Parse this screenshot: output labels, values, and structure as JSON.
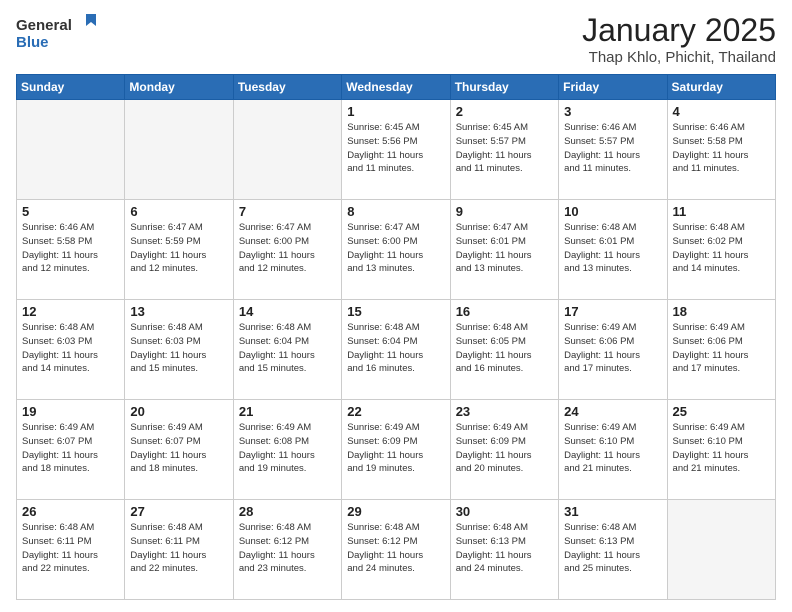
{
  "logo": {
    "line1": "General",
    "line2": "Blue"
  },
  "header": {
    "month": "January 2025",
    "location": "Thap Khlo, Phichit, Thailand"
  },
  "weekdays": [
    "Sunday",
    "Monday",
    "Tuesday",
    "Wednesday",
    "Thursday",
    "Friday",
    "Saturday"
  ],
  "weeks": [
    [
      {
        "day": "",
        "info": ""
      },
      {
        "day": "",
        "info": ""
      },
      {
        "day": "",
        "info": ""
      },
      {
        "day": "1",
        "info": "Sunrise: 6:45 AM\nSunset: 5:56 PM\nDaylight: 11 hours\nand 11 minutes."
      },
      {
        "day": "2",
        "info": "Sunrise: 6:45 AM\nSunset: 5:57 PM\nDaylight: 11 hours\nand 11 minutes."
      },
      {
        "day": "3",
        "info": "Sunrise: 6:46 AM\nSunset: 5:57 PM\nDaylight: 11 hours\nand 11 minutes."
      },
      {
        "day": "4",
        "info": "Sunrise: 6:46 AM\nSunset: 5:58 PM\nDaylight: 11 hours\nand 11 minutes."
      }
    ],
    [
      {
        "day": "5",
        "info": "Sunrise: 6:46 AM\nSunset: 5:58 PM\nDaylight: 11 hours\nand 12 minutes."
      },
      {
        "day": "6",
        "info": "Sunrise: 6:47 AM\nSunset: 5:59 PM\nDaylight: 11 hours\nand 12 minutes."
      },
      {
        "day": "7",
        "info": "Sunrise: 6:47 AM\nSunset: 6:00 PM\nDaylight: 11 hours\nand 12 minutes."
      },
      {
        "day": "8",
        "info": "Sunrise: 6:47 AM\nSunset: 6:00 PM\nDaylight: 11 hours\nand 13 minutes."
      },
      {
        "day": "9",
        "info": "Sunrise: 6:47 AM\nSunset: 6:01 PM\nDaylight: 11 hours\nand 13 minutes."
      },
      {
        "day": "10",
        "info": "Sunrise: 6:48 AM\nSunset: 6:01 PM\nDaylight: 11 hours\nand 13 minutes."
      },
      {
        "day": "11",
        "info": "Sunrise: 6:48 AM\nSunset: 6:02 PM\nDaylight: 11 hours\nand 14 minutes."
      }
    ],
    [
      {
        "day": "12",
        "info": "Sunrise: 6:48 AM\nSunset: 6:03 PM\nDaylight: 11 hours\nand 14 minutes."
      },
      {
        "day": "13",
        "info": "Sunrise: 6:48 AM\nSunset: 6:03 PM\nDaylight: 11 hours\nand 15 minutes."
      },
      {
        "day": "14",
        "info": "Sunrise: 6:48 AM\nSunset: 6:04 PM\nDaylight: 11 hours\nand 15 minutes."
      },
      {
        "day": "15",
        "info": "Sunrise: 6:48 AM\nSunset: 6:04 PM\nDaylight: 11 hours\nand 16 minutes."
      },
      {
        "day": "16",
        "info": "Sunrise: 6:48 AM\nSunset: 6:05 PM\nDaylight: 11 hours\nand 16 minutes."
      },
      {
        "day": "17",
        "info": "Sunrise: 6:49 AM\nSunset: 6:06 PM\nDaylight: 11 hours\nand 17 minutes."
      },
      {
        "day": "18",
        "info": "Sunrise: 6:49 AM\nSunset: 6:06 PM\nDaylight: 11 hours\nand 17 minutes."
      }
    ],
    [
      {
        "day": "19",
        "info": "Sunrise: 6:49 AM\nSunset: 6:07 PM\nDaylight: 11 hours\nand 18 minutes."
      },
      {
        "day": "20",
        "info": "Sunrise: 6:49 AM\nSunset: 6:07 PM\nDaylight: 11 hours\nand 18 minutes."
      },
      {
        "day": "21",
        "info": "Sunrise: 6:49 AM\nSunset: 6:08 PM\nDaylight: 11 hours\nand 19 minutes."
      },
      {
        "day": "22",
        "info": "Sunrise: 6:49 AM\nSunset: 6:09 PM\nDaylight: 11 hours\nand 19 minutes."
      },
      {
        "day": "23",
        "info": "Sunrise: 6:49 AM\nSunset: 6:09 PM\nDaylight: 11 hours\nand 20 minutes."
      },
      {
        "day": "24",
        "info": "Sunrise: 6:49 AM\nSunset: 6:10 PM\nDaylight: 11 hours\nand 21 minutes."
      },
      {
        "day": "25",
        "info": "Sunrise: 6:49 AM\nSunset: 6:10 PM\nDaylight: 11 hours\nand 21 minutes."
      }
    ],
    [
      {
        "day": "26",
        "info": "Sunrise: 6:48 AM\nSunset: 6:11 PM\nDaylight: 11 hours\nand 22 minutes."
      },
      {
        "day": "27",
        "info": "Sunrise: 6:48 AM\nSunset: 6:11 PM\nDaylight: 11 hours\nand 22 minutes."
      },
      {
        "day": "28",
        "info": "Sunrise: 6:48 AM\nSunset: 6:12 PM\nDaylight: 11 hours\nand 23 minutes."
      },
      {
        "day": "29",
        "info": "Sunrise: 6:48 AM\nSunset: 6:12 PM\nDaylight: 11 hours\nand 24 minutes."
      },
      {
        "day": "30",
        "info": "Sunrise: 6:48 AM\nSunset: 6:13 PM\nDaylight: 11 hours\nand 24 minutes."
      },
      {
        "day": "31",
        "info": "Sunrise: 6:48 AM\nSunset: 6:13 PM\nDaylight: 11 hours\nand 25 minutes."
      },
      {
        "day": "",
        "info": ""
      }
    ]
  ]
}
